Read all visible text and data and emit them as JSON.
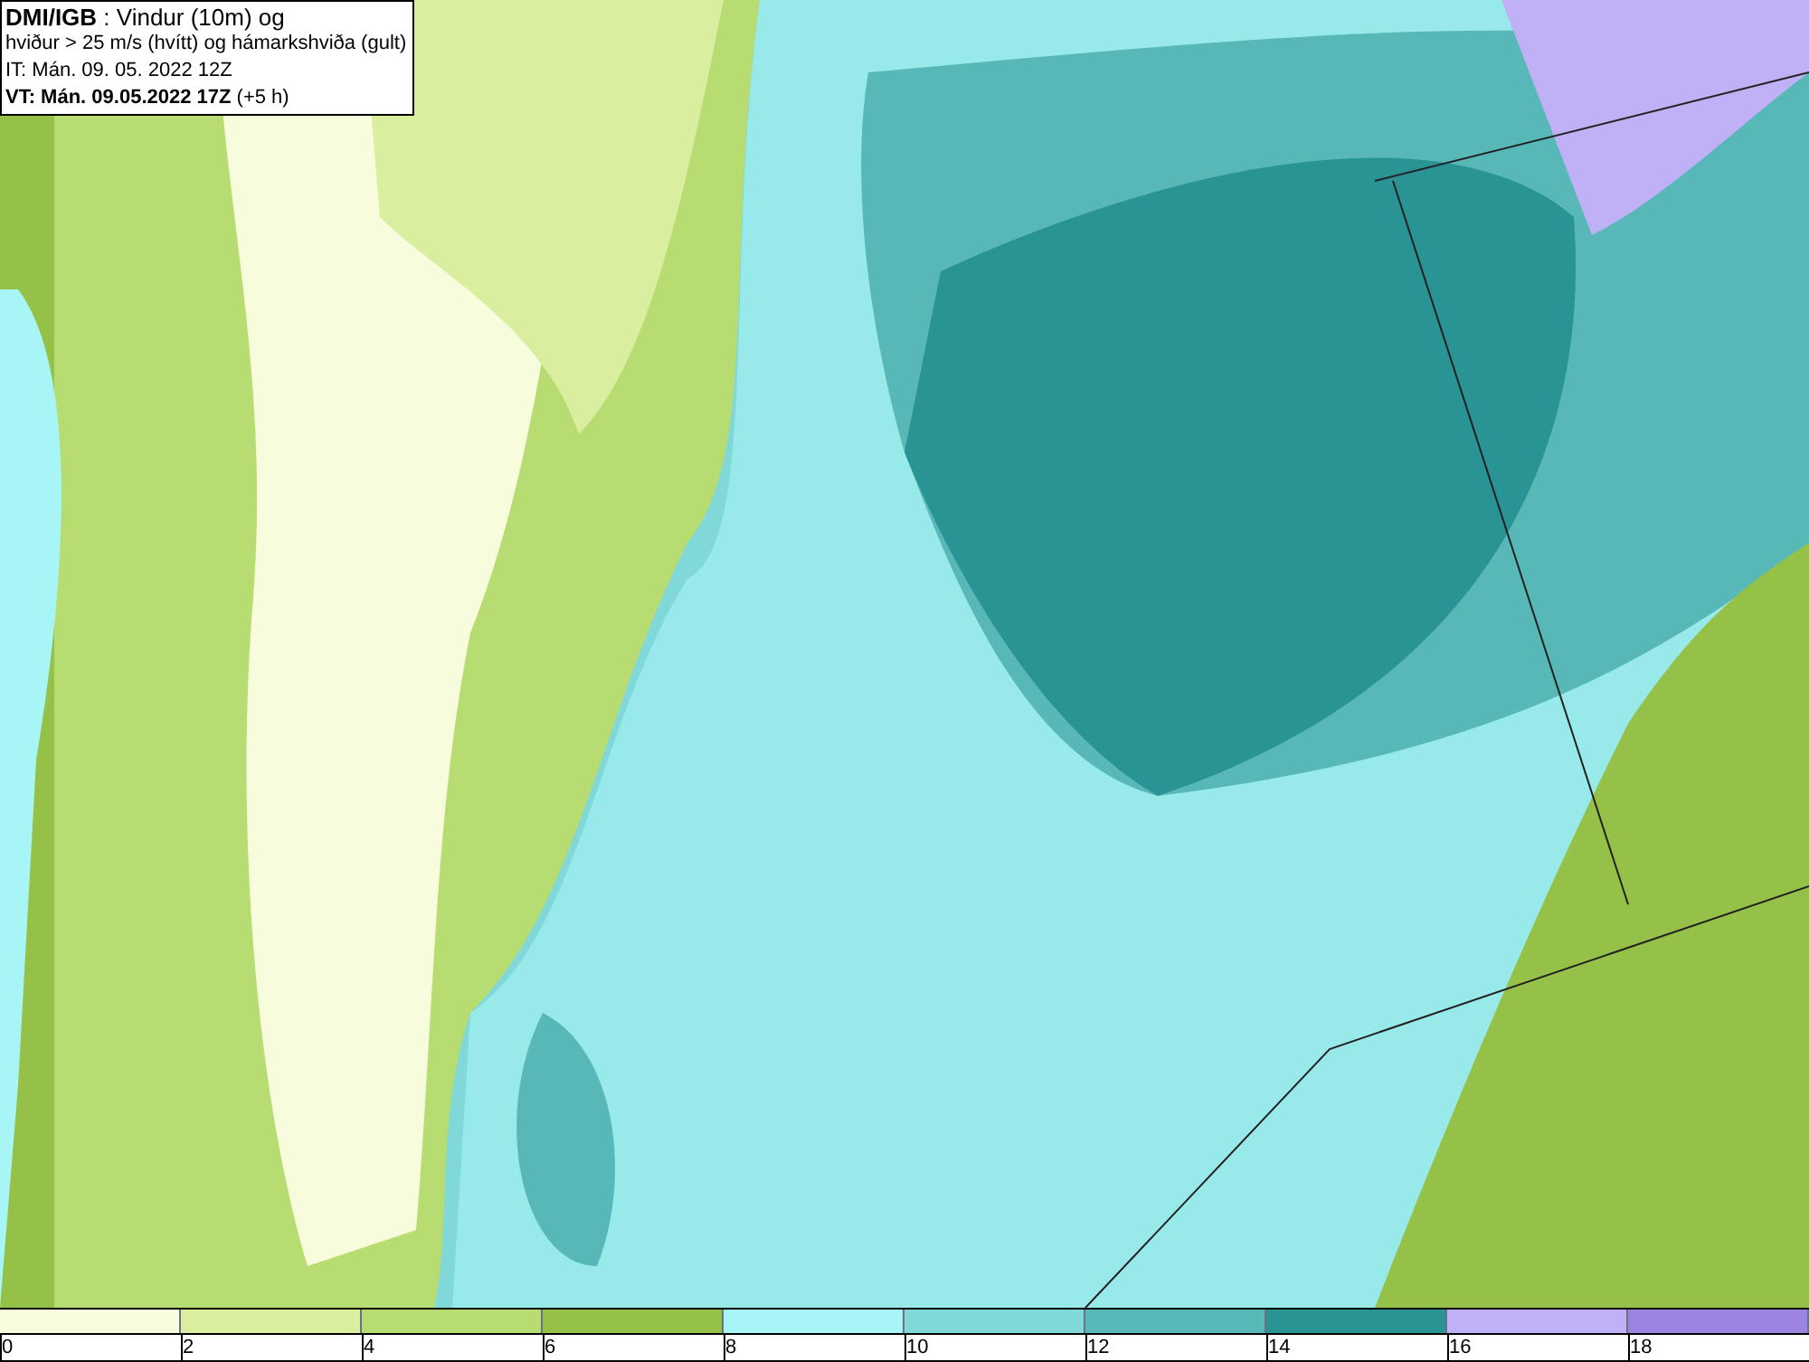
{
  "info_box": {
    "lines": [
      "**DMI/IGB** : Vindur (10m) og",
      "hviður > 25 m/s (hvítt) og hámarkshviða (gult)",
      "IT: Mán. 09. 05. 2022 12Z",
      "**VT: Mán. 09.05.2022 17Z** (+5 h)"
    ]
  },
  "legend": {
    "segments": [
      {
        "color": "#f7fcdc"
      },
      {
        "color": "#d9ee9f"
      },
      {
        "color": "#b6dc72"
      },
      {
        "color": "#96c148"
      },
      {
        "color": "#a8f5f5"
      },
      {
        "color": "#80d8d8"
      },
      {
        "color": "#58b8b8"
      },
      {
        "color": "#2a9494"
      },
      {
        "color": "#c0b0f5"
      },
      {
        "color": "#9c84e0"
      }
    ],
    "ticks": [
      "0",
      "2",
      "4",
      "6",
      "8",
      "10",
      "12",
      "14",
      "16",
      "18"
    ]
  }
}
